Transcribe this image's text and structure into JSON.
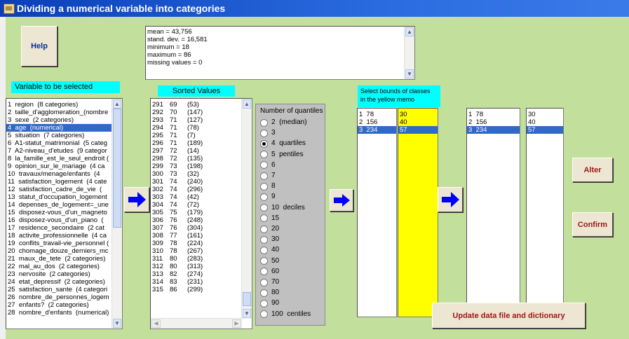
{
  "window": {
    "title": "Dividing a numerical variable into categories"
  },
  "help_button": "Help",
  "stats_memo": {
    "lines": [
      "mean = 43,756",
      "stand. dev. = 16,581",
      "minimum = 18",
      "maximum = 86",
      "missing values = 0"
    ]
  },
  "variable_panel": {
    "header": "Variable to be selected",
    "selected_index": 3,
    "items": [
      "1  region  (8 categories)",
      "2  taille_d'agglomeration_(nombre",
      "3  sexe  (2 categories)",
      "4  age  (numerical)",
      "5  situation  (7 categories)",
      "6  A1-statut_matrimonial  (5 categ",
      "7  A2-niveau_d'etudes  (9 categor",
      "8  la_famille_est_le_seul_endroit (",
      "9  opinion_sur_le_mariage  (4 ca",
      "10  travaux/menage/enfants  (4",
      "11  satisfaction_logement  (4 cate",
      "12  satisfaction_cadre_de_vie  (",
      "13  statut_d'occupation_logement",
      "14  depenses_de_logement=_une",
      "15  disposez-vous_d'un_magneto",
      "16  disposez-vous_d'un_piano  (",
      "17  residence_secondaire  (2 cat",
      "18  activite_professionnelle  (4 ca",
      "19  conflits_travail-vie_personnel (",
      "20  chomage_douze_derniers_mc",
      "21  maux_de_tete  (2 categories)",
      "22  mal_au_dos  (2 categories)",
      "23  nervosite  (2 categories)",
      "24  etat_depressif  (2 categories)",
      "25  satisfaction_sante  (4 categori",
      "26  nombre_de_personnes_logem",
      "27  enfants?  (2 categories)",
      "28  nombre_d'enfants  (numerical)"
    ]
  },
  "sorted_panel": {
    "header": "Sorted Values",
    "rows": [
      [
        "291",
        "69",
        "(53)"
      ],
      [
        "292",
        "70",
        "(147)"
      ],
      [
        "293",
        "71",
        "(127)"
      ],
      [
        "294",
        "71",
        "(78)"
      ],
      [
        "295",
        "71",
        "(7)"
      ],
      [
        "296",
        "71",
        "(189)"
      ],
      [
        "297",
        "72",
        "(14)"
      ],
      [
        "298",
        "72",
        "(135)"
      ],
      [
        "299",
        "73",
        "(198)"
      ],
      [
        "300",
        "73",
        "(32)"
      ],
      [
        "301",
        "74",
        "(240)"
      ],
      [
        "302",
        "74",
        "(296)"
      ],
      [
        "303",
        "74",
        "(42)"
      ],
      [
        "304",
        "74",
        "(72)"
      ],
      [
        "305",
        "75",
        "(179)"
      ],
      [
        "306",
        "76",
        "(248)"
      ],
      [
        "307",
        "76",
        "(304)"
      ],
      [
        "308",
        "77",
        "(161)"
      ],
      [
        "309",
        "78",
        "(224)"
      ],
      [
        "310",
        "78",
        "(267)"
      ],
      [
        "311",
        "80",
        "(283)"
      ],
      [
        "312",
        "80",
        "(313)"
      ],
      [
        "313",
        "82",
        "(274)"
      ],
      [
        "314",
        "83",
        "(231)"
      ],
      [
        "315",
        "86",
        "(299)"
      ]
    ]
  },
  "quantiles": {
    "title": "Number of quantiles",
    "selected": "4  quartiles",
    "options": [
      "2  (median)",
      "3",
      "4  quartiles",
      "5  pentiles",
      "6",
      "7",
      "8",
      "9",
      "10  deciles",
      "15",
      "20",
      "30",
      "40",
      "50",
      "60",
      "70",
      "80",
      "90",
      "100  centiles"
    ]
  },
  "bounds_panel": {
    "header_line1": "Select bounds of classes",
    "header_line2": "in the yellow memo",
    "left_rows": [
      "1  78",
      "2  156",
      "3  234"
    ],
    "yellow_rows": [
      "30",
      "40",
      "57"
    ],
    "selected_index": 2
  },
  "result_panel": {
    "left_rows": [
      "1  78",
      "2  156",
      "3  234"
    ],
    "right_rows": [
      "30",
      "40",
      "57"
    ],
    "selected_index": 2
  },
  "buttons": {
    "alter": "Alter",
    "confirm": "Confirm",
    "update": "Update data file and dictionary"
  },
  "colors": {
    "background": "#c2df9b",
    "title_bar": "#0a3fb8",
    "header_cyan": "#00ffff",
    "memo_yellow": "#ffff00",
    "selection": "#316ac5",
    "arrow_blue": "#0000ff"
  }
}
